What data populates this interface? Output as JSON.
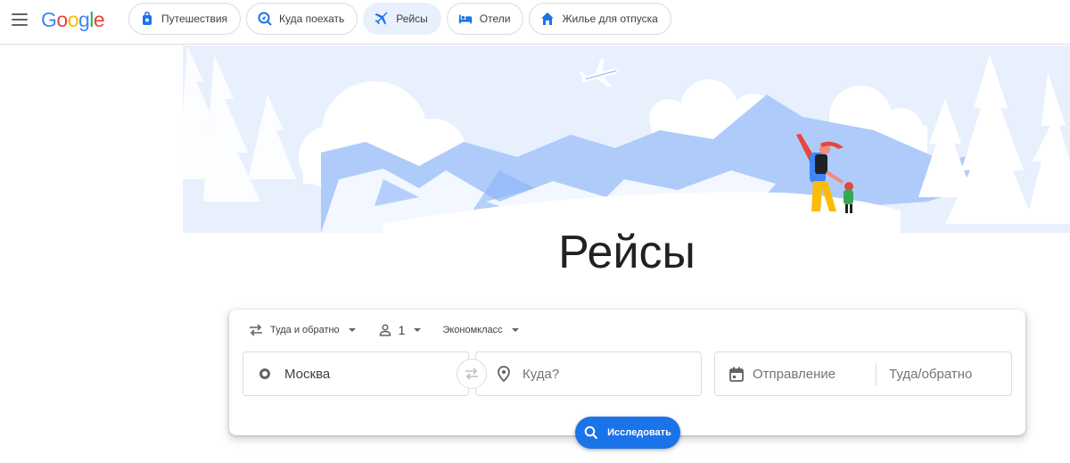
{
  "header": {
    "menu_icon": "hamburger-menu-icon",
    "logo": "Google",
    "chips": [
      {
        "label": "Путешествия",
        "icon": "luggage-icon",
        "active": false
      },
      {
        "label": "Куда поехать",
        "icon": "explore-icon",
        "active": false
      },
      {
        "label": "Рейсы",
        "icon": "airplane-icon",
        "active": true
      },
      {
        "label": "Отели",
        "icon": "bed-icon",
        "active": false
      },
      {
        "label": "Жилье для отпуска",
        "icon": "house-icon",
        "active": false
      }
    ]
  },
  "main": {
    "title": "Рейсы"
  },
  "search": {
    "trip_type": "Туда и обратно",
    "passengers": "1",
    "cabin_class": "Экономкласс",
    "from_value": "Москва",
    "to_placeholder": "Куда?",
    "departure_placeholder": "Отправление",
    "return_placeholder": "Туда/обратно",
    "explore_label": "Исследовать"
  },
  "colors": {
    "accent": "#1a73e8",
    "chip_active_bg": "#e8f0fe",
    "hero_blue": "#aecbfa",
    "hero_light": "#e8f0fe"
  }
}
